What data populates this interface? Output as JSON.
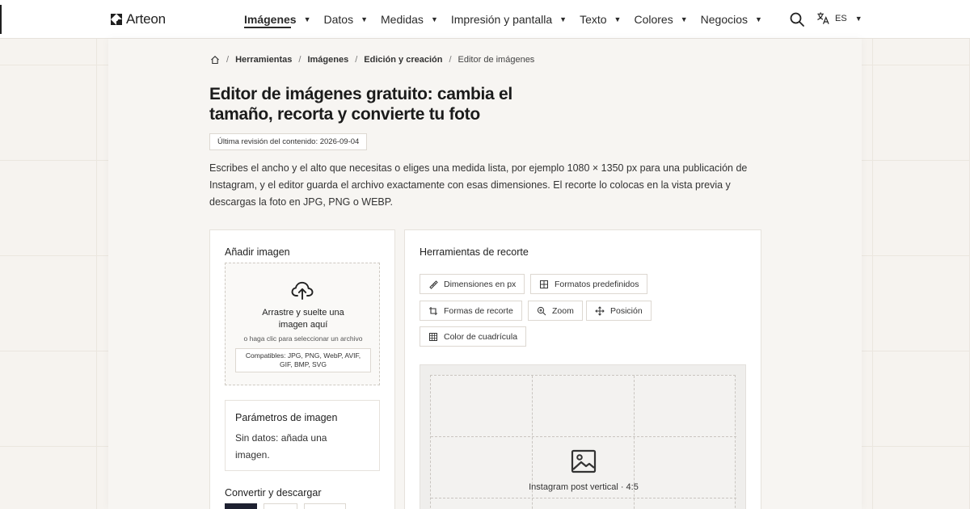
{
  "brand": {
    "name": "Arteon"
  },
  "nav": {
    "items": [
      {
        "label": "Imágenes",
        "active": true
      },
      {
        "label": "Datos"
      },
      {
        "label": "Medidas"
      },
      {
        "label": "Impresión y pantalla"
      },
      {
        "label": "Texto"
      },
      {
        "label": "Colores"
      },
      {
        "label": "Negocios"
      }
    ],
    "caret": "▼",
    "language": "ES"
  },
  "breadcrumb": {
    "items": [
      "Herramientas",
      "Imágenes",
      "Edición y creación"
    ],
    "current": "Editor de imágenes",
    "separator": "/"
  },
  "page": {
    "title": "Editor de imágenes gratuito: cambia el tamaño, recorta y convierte tu foto",
    "revision": "Última revisión del contenido: 2026-09-04",
    "intro": "Escribes el ancho y el alto que necesitas o eliges una medida lista, por ejemplo 1080 × 1350 px para una publicación de Instagram, y el editor guarda el archivo exactamente con esas dimensiones. El recorte lo colocas en la vista previa y descargas la foto en JPG, PNG o WEBP."
  },
  "upload": {
    "title": "Añadir imagen",
    "drop_text": "Arrastre y suelte una imagen aquí",
    "click_text": "o haga clic para seleccionar un archivo",
    "formats": "Compatibles: JPG, PNG, WebP, AVIF, GIF, BMP, SVG"
  },
  "params": {
    "title": "Parámetros de imagen",
    "empty": "Sin datos: añada una imagen."
  },
  "convert": {
    "title": "Convertir y descargar"
  },
  "crop": {
    "title": "Herramientas de recorte",
    "tools": [
      {
        "label": "Dimensiones en px",
        "icon": "ruler-icon"
      },
      {
        "label": "Formatos predefinidos",
        "icon": "grid-icon"
      },
      {
        "label": "Formas de recorte",
        "icon": "crop-icon"
      },
      {
        "label": "Zoom",
        "icon": "zoom-icon"
      },
      {
        "label": "Posición",
        "icon": "move-icon"
      },
      {
        "label": "Color de cuadrícula",
        "icon": "grid-icon"
      }
    ],
    "preview_label": "Instagram post vertical · 4:5"
  },
  "colors": {
    "accent_dark": "#1e2131",
    "background": "#f6f3ef",
    "panel": "#ffffff"
  }
}
